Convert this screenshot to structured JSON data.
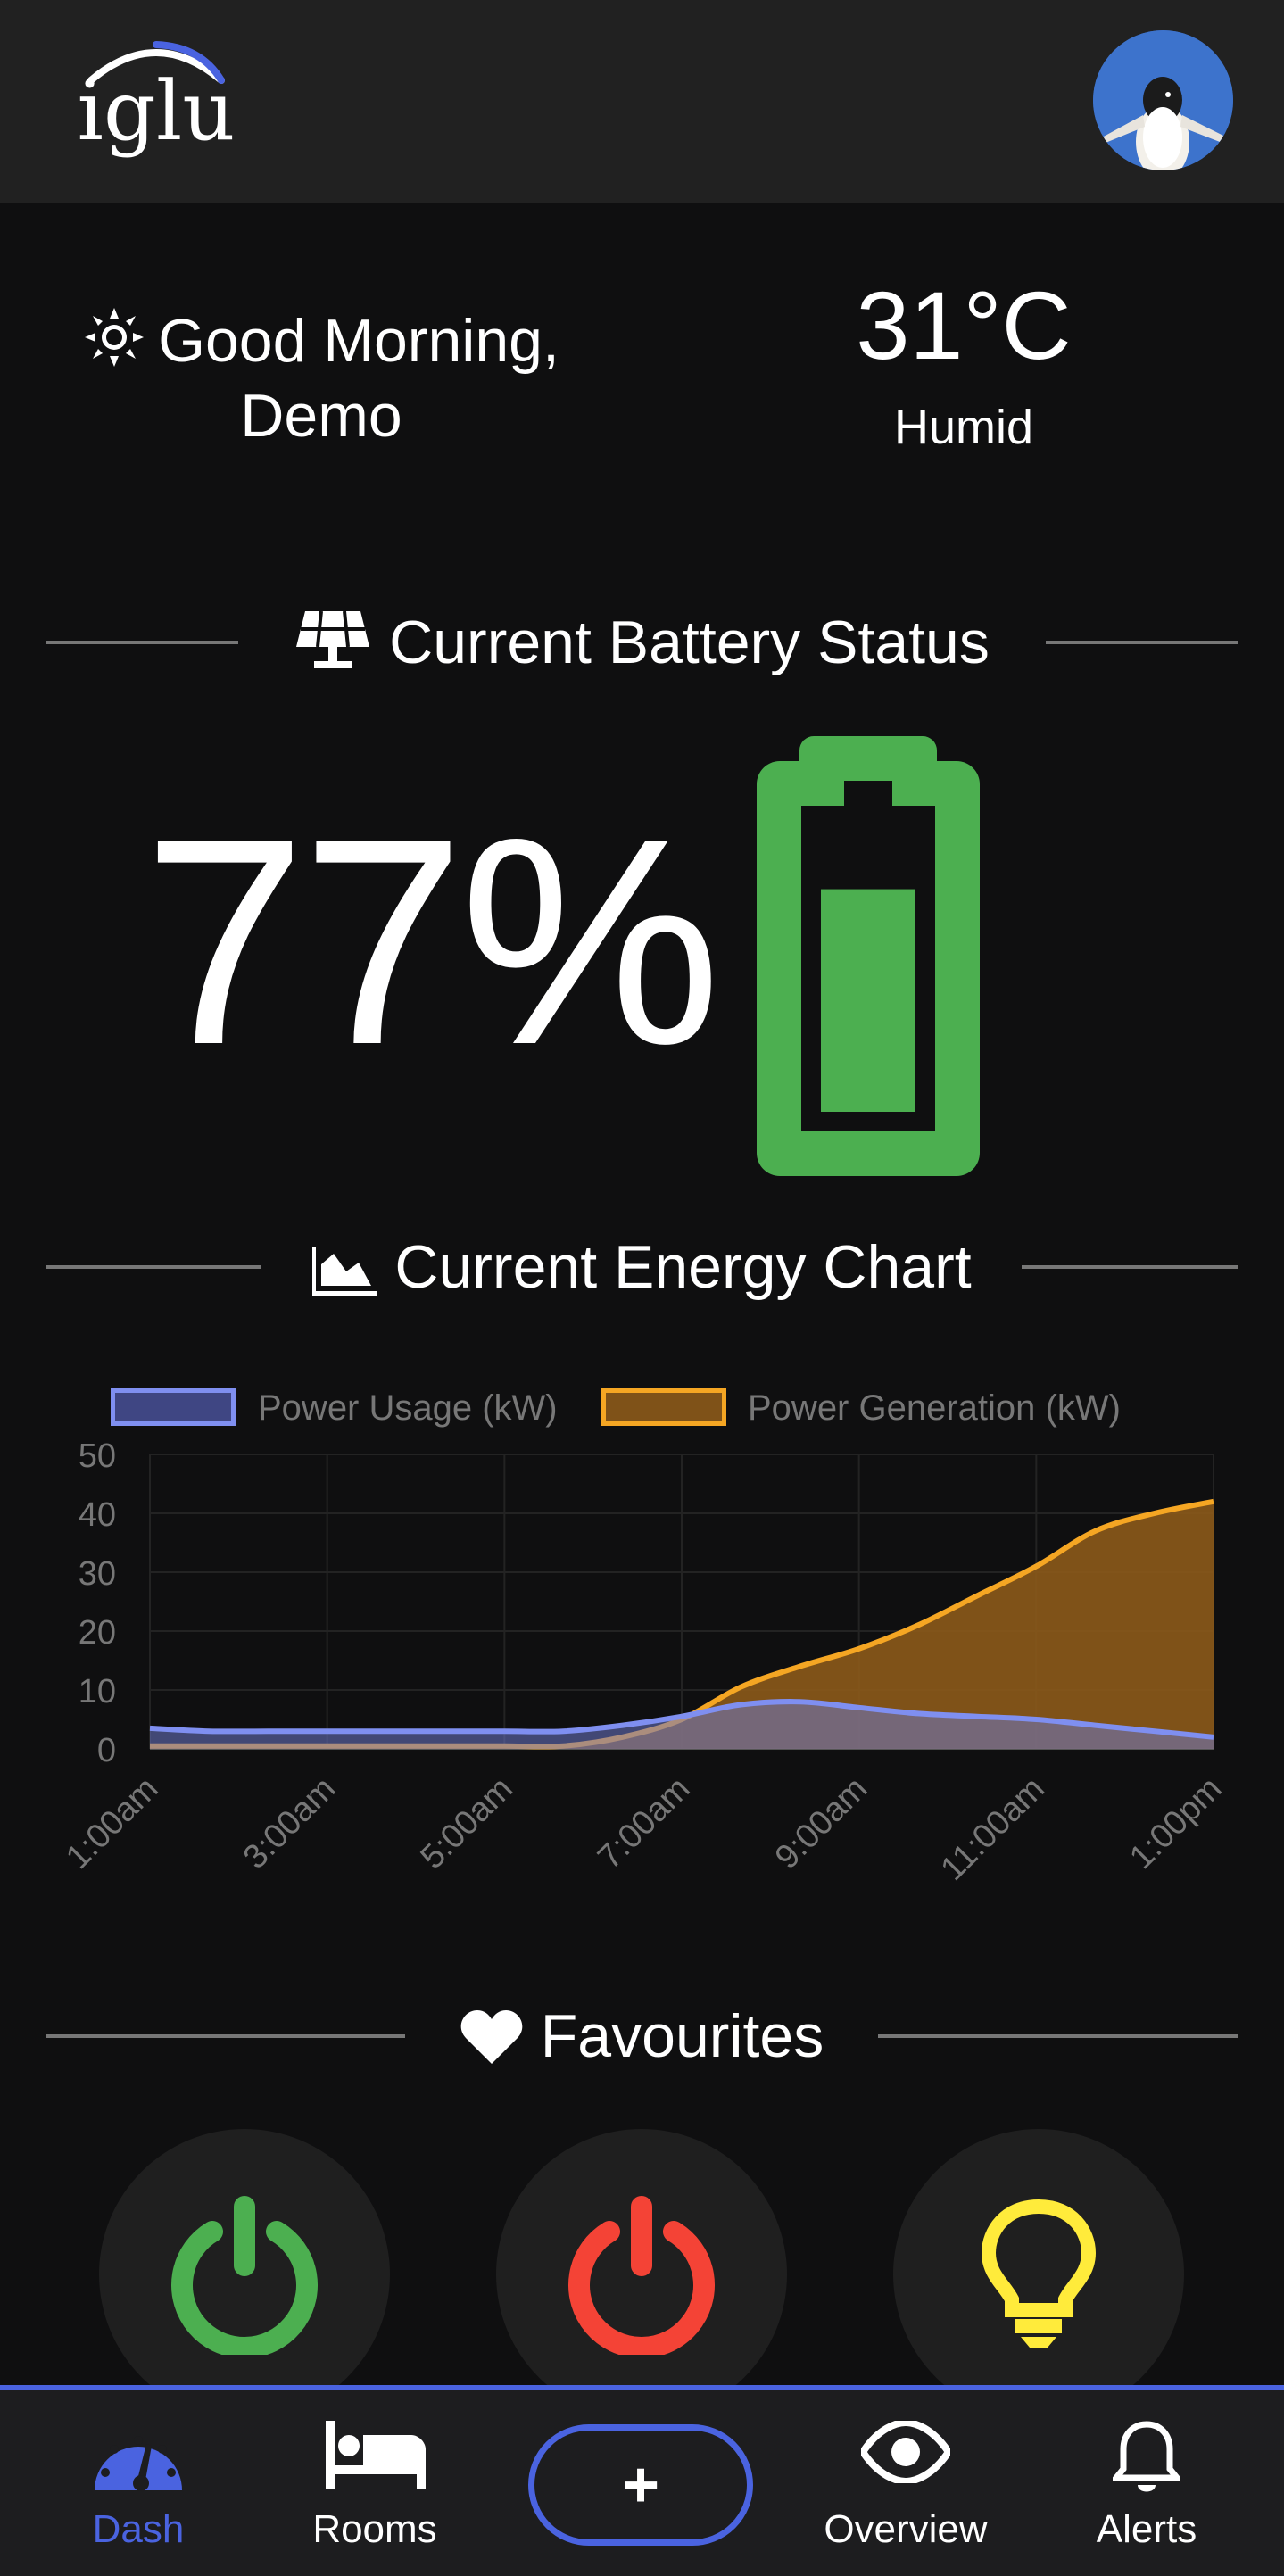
{
  "app": {
    "logo_text": "iglu"
  },
  "greeting": {
    "line1": "Good Morning,",
    "line2": "Demo"
  },
  "weather": {
    "temperature": "31°C",
    "condition": "Humid"
  },
  "battery_section": {
    "title": "Current Battery Status",
    "percent": "77%",
    "level": 0.77,
    "color": "#4caf50"
  },
  "chart_section": {
    "title": "Current Energy Chart"
  },
  "chart_data": {
    "type": "area",
    "x": [
      "1:00am",
      "2:00am",
      "3:00am",
      "4:00am",
      "5:00am",
      "6:00am",
      "7:00am",
      "7:30am",
      "8:00am",
      "8:30am",
      "9:00am",
      "9:30am",
      "10:00am",
      "10:30am",
      "11:00am",
      "11:30am",
      "12:00pm",
      "12:30pm",
      "1:00pm"
    ],
    "tick_labels": [
      "1:00am",
      "3:00am",
      "5:00am",
      "7:00am",
      "9:00am",
      "11:00am",
      "1:00pm"
    ],
    "series": [
      {
        "name": "Power Usage (kW)",
        "color": "#7f8ff0",
        "values": [
          3.5,
          3,
          3,
          3,
          3,
          3,
          3,
          3,
          4,
          5.5,
          7.5,
          8,
          7,
          6,
          5.5,
          5,
          4,
          3,
          2
        ]
      },
      {
        "name": "Power Generation (kW)",
        "color": "#f5a623",
        "values": [
          0.5,
          0.5,
          0.5,
          0.5,
          0.5,
          0.5,
          0.5,
          0.5,
          2,
          5,
          10.5,
          14,
          17,
          21,
          26,
          31,
          37,
          40,
          42
        ]
      }
    ],
    "yticks": [
      "50",
      "40",
      "30",
      "20",
      "10",
      "0"
    ],
    "ylim": [
      0,
      50
    ],
    "grid": true,
    "legend": "top"
  },
  "favourites_section": {
    "title": "Favourites"
  },
  "favourites": [
    {
      "icon": "power-icon",
      "color": "#4caf50"
    },
    {
      "icon": "power-icon",
      "color": "#f44336"
    },
    {
      "icon": "lightbulb-icon",
      "color": "#ffeb3b"
    }
  ],
  "nav": {
    "dash": "Dash",
    "rooms": "Rooms",
    "add": "+",
    "overview": "Overview",
    "alerts": "Alerts",
    "active_color": "#4a63e0"
  }
}
